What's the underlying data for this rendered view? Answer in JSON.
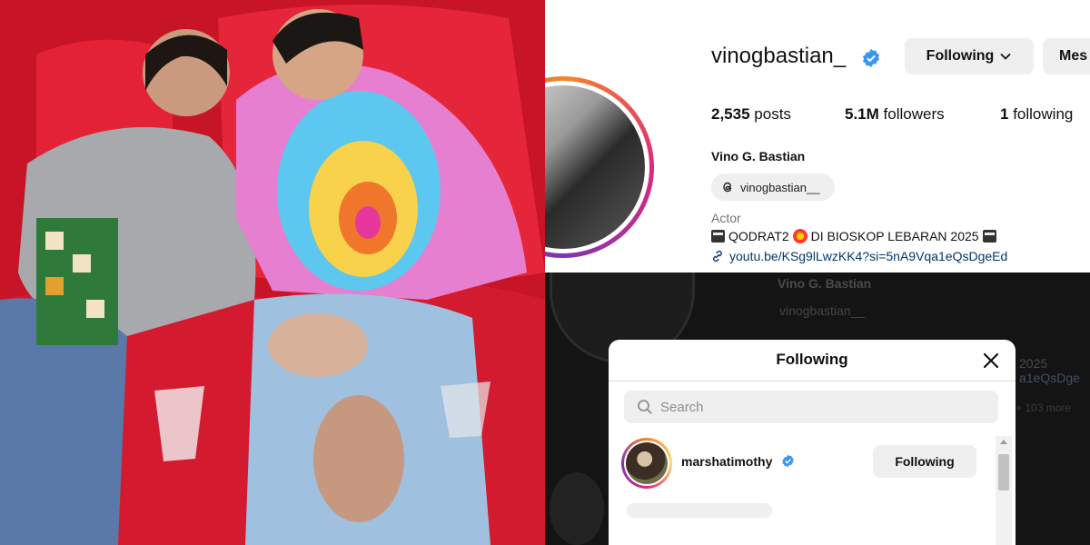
{
  "profile": {
    "username": "vinogbastian_",
    "following_button": "Following",
    "message_button": "Mes",
    "posts_count": "2,535",
    "posts_label": "posts",
    "followers_count": "5.1M",
    "followers_label": "followers",
    "following_count": "1",
    "following_label": "following",
    "full_name": "Vino G. Bastian",
    "threads_handle": "vinogbastian__",
    "category": "Actor",
    "bio_part1": "QODRAT2",
    "bio_part2": "DI BIOSKOP LEBARAN 2025",
    "link": "youtu.be/KSg9lLwzKK4?si=5nA9Vqa1eQsDgeEd"
  },
  "background": {
    "name": "Vino G. Bastian",
    "threads_handle": "vinogbastian__",
    "bio_fragment": "2025",
    "link_fragment": "a1eQsDge",
    "more": "+ 103 more"
  },
  "modal": {
    "title": "Following",
    "search_placeholder": "Search",
    "rows": [
      {
        "username": "marshatimothy",
        "button": "Following"
      }
    ]
  },
  "colors": {
    "verified": "#3897f0",
    "link": "#00376b",
    "button_bg": "#efefef",
    "seat_red": "#d3162b"
  },
  "icons": [
    "verified-badge-icon",
    "chevron-down-icon",
    "threads-icon",
    "link-icon",
    "close-icon",
    "search-icon"
  ]
}
